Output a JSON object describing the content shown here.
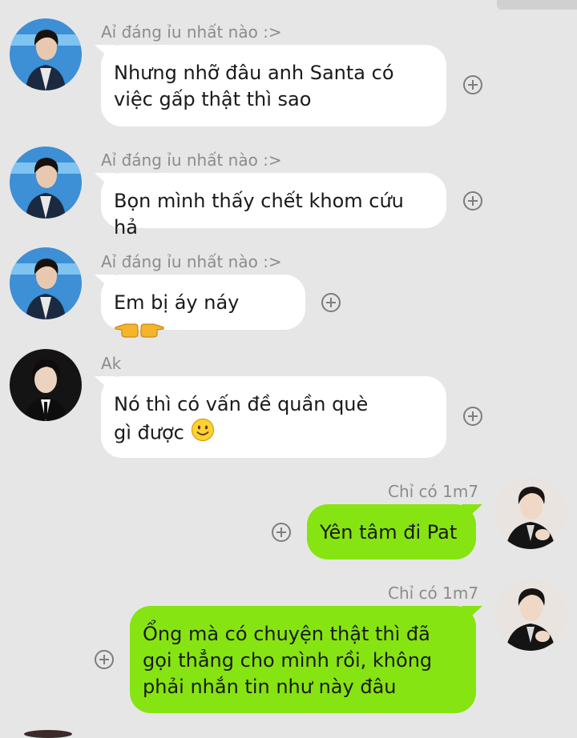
{
  "messages": [
    {
      "sender": "Aỉ đáng ỉu nhất nào :>",
      "text": "Nhưng nhỡ đâu anh Santa có việc gấp thật thì sao"
    },
    {
      "sender": "Aỉ đáng ỉu nhất nào :>",
      "text": "Bọn mình thấy chết khom cứu hả"
    },
    {
      "sender": "Aỉ đáng ỉu nhất nào :>",
      "text": "Em bị áy náy",
      "emoji": "pointing-hands-emoji"
    },
    {
      "sender": "Ak",
      "text_line1": "Nó thì có vấn đề quần què",
      "text_line2": "gì được",
      "emoji": "smiling-face-emoji"
    },
    {
      "sender": "Chỉ có 1m7",
      "text": "Yên tâm đi Pat"
    },
    {
      "sender": "Chỉ có 1m7",
      "text": "Ổng mà có chuyện thật thì đã gọi thẳng cho mình rồi, không phải nhắn tin như này đâu"
    }
  ],
  "colors": {
    "background": "#e6e6e6",
    "incoming_bubble": "#ffffff",
    "outgoing_bubble": "#86e412",
    "sender_name": "#8c8c8c"
  },
  "icons": [
    "add-reaction-icon",
    "avatar-photo"
  ]
}
